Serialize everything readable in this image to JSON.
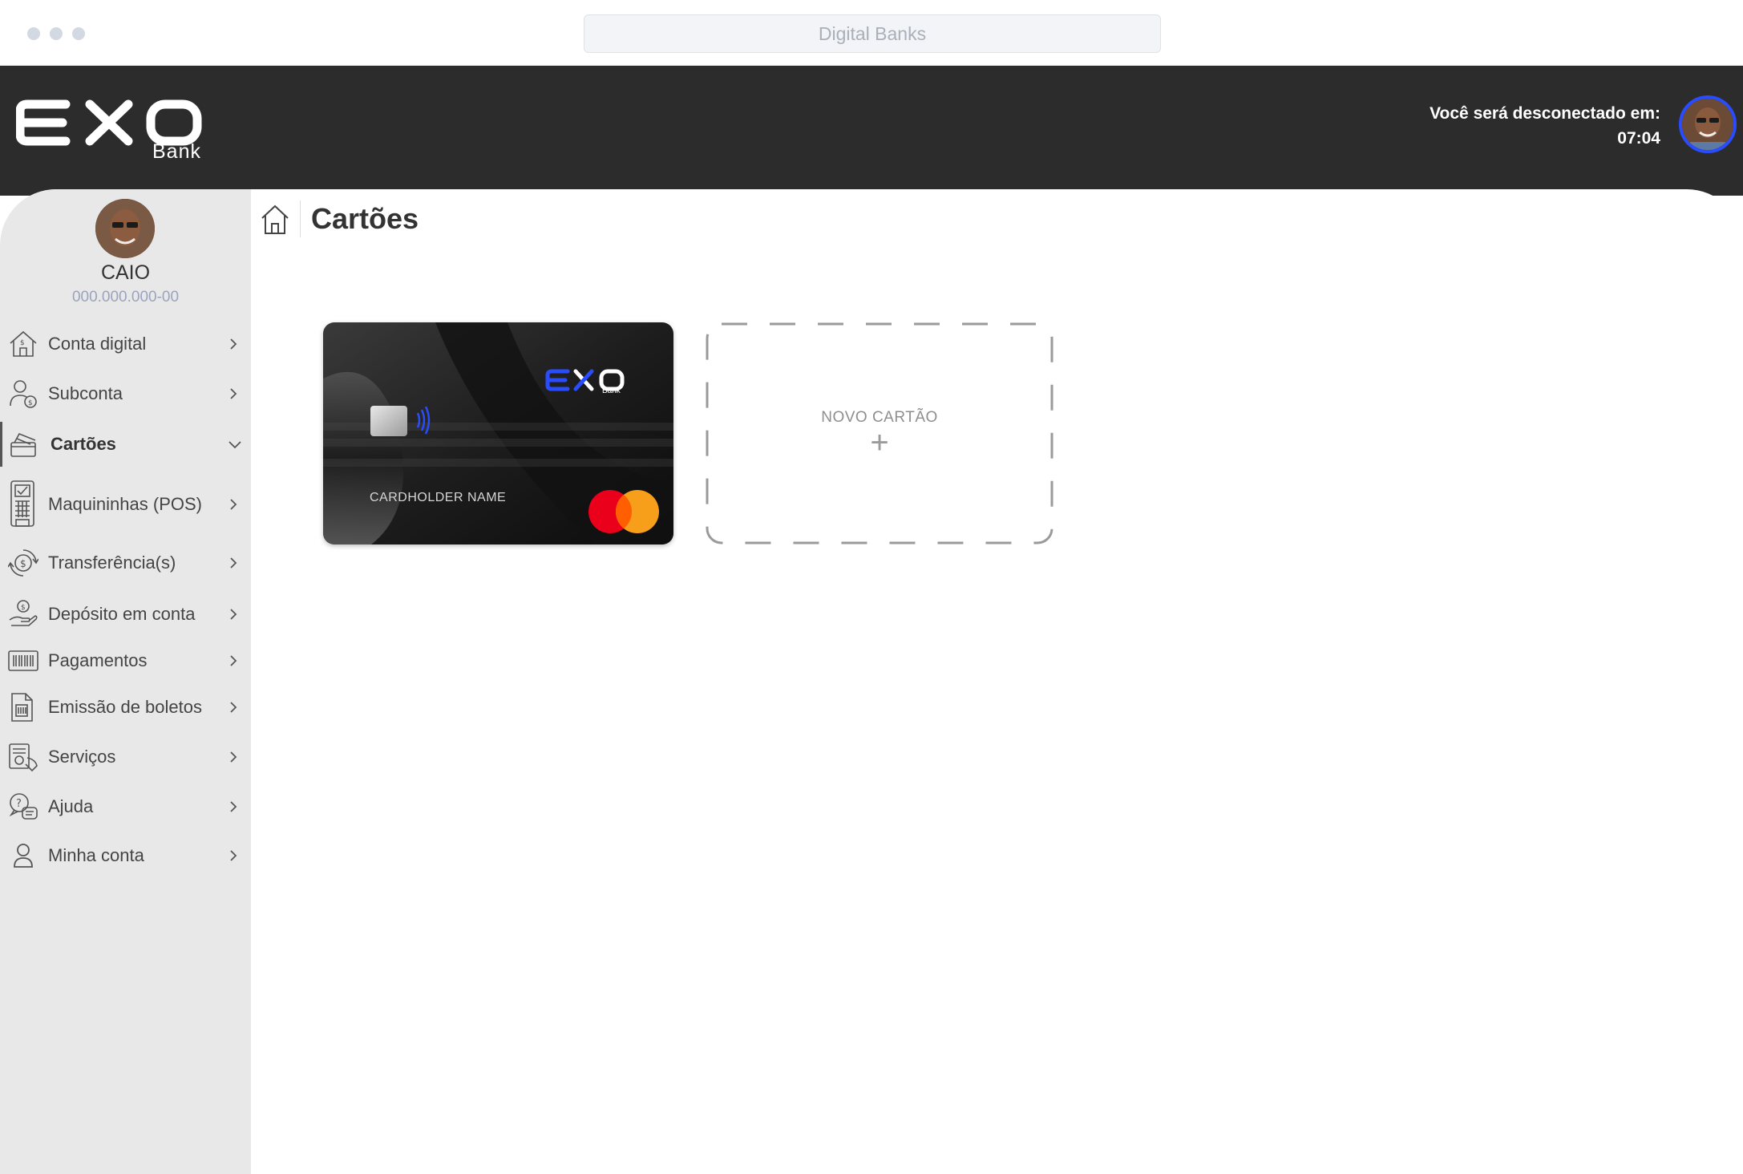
{
  "browser": {
    "address_text": "Digital Banks"
  },
  "header": {
    "logo_text": "EXO",
    "logo_subtitle": "Bank",
    "session_label": "Você será desconectado em:",
    "session_time": "07:04"
  },
  "user": {
    "name": "CAIO",
    "document": "000.000.000-00"
  },
  "sidebar": {
    "items": [
      {
        "label": "Conta digital",
        "icon": "home-dollar-icon",
        "expanded": false
      },
      {
        "label": "Subconta",
        "icon": "user-coin-icon",
        "expanded": false
      },
      {
        "label": "Cartões",
        "icon": "card-stack-icon",
        "expanded": true,
        "active": true
      },
      {
        "label": "Maquininhas (POS)",
        "icon": "pos-terminal-icon",
        "expanded": false
      },
      {
        "label": "Transferência(s)",
        "icon": "transfer-coin-icon",
        "expanded": false
      },
      {
        "label": "Depósito em conta",
        "icon": "hand-coin-icon",
        "expanded": false
      },
      {
        "label": "Pagamentos",
        "icon": "barcode-icon",
        "expanded": false
      },
      {
        "label": "Emissão de boletos",
        "icon": "bill-document-icon",
        "expanded": false
      },
      {
        "label": "Serviços",
        "icon": "services-icon",
        "expanded": false
      },
      {
        "label": "Ajuda",
        "icon": "help-chat-icon",
        "expanded": false
      },
      {
        "label": "Minha conta",
        "icon": "user-icon",
        "expanded": false
      }
    ]
  },
  "main": {
    "page_title": "Cartões",
    "card": {
      "holder": "CARDHOLDER NAME",
      "brand_logo": "EXO",
      "brand_sub": "Bank",
      "network": "mastercard"
    },
    "new_card": {
      "label": "NOVO CARTÃO",
      "plus": "+"
    }
  },
  "colors": {
    "header_bg": "#2c2c2c",
    "sidebar_bg": "#e8e8e8",
    "accent_blue": "#2a4cff",
    "card_bg": "#1a1a1a"
  }
}
